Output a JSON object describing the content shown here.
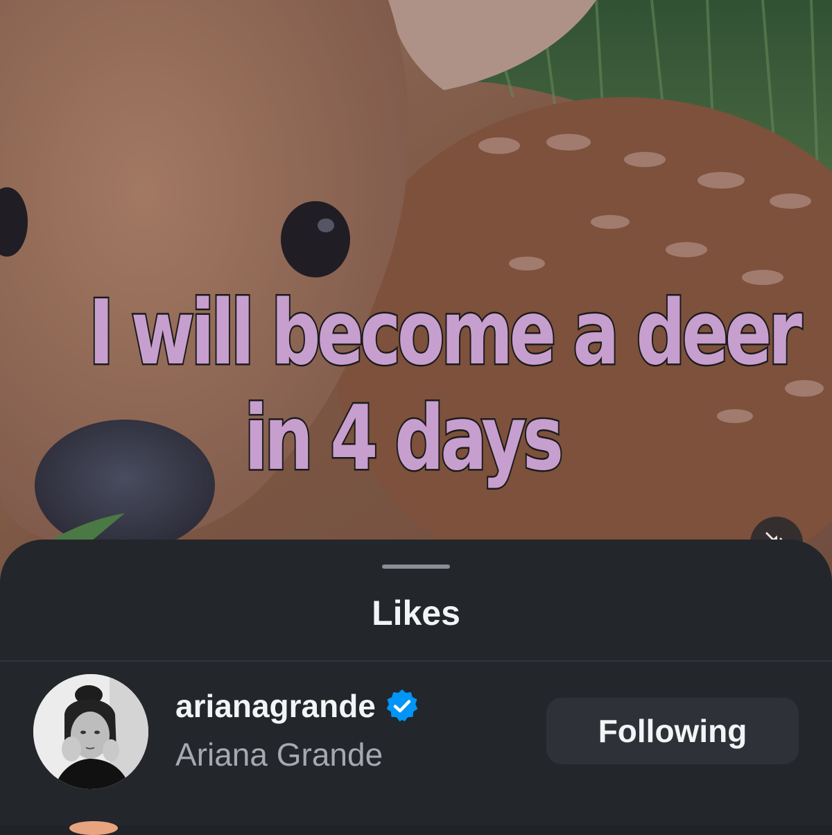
{
  "post": {
    "overlay_text_line1": "I will become a deer",
    "overlay_text_line2": "in 4 days",
    "mute_icon": "speaker-muted-icon"
  },
  "likes_sheet": {
    "title": "Likes",
    "users": [
      {
        "username": "arianagrande",
        "full_name": "Ariana Grande",
        "verified": true,
        "verified_icon": "verified-badge-icon",
        "follow_state": "Following"
      }
    ]
  },
  "colors": {
    "sheet_background": "#23262b",
    "button_background": "#2e3238",
    "verified_blue": "#0095f6",
    "overlay_text_fill": "#c79fce"
  }
}
